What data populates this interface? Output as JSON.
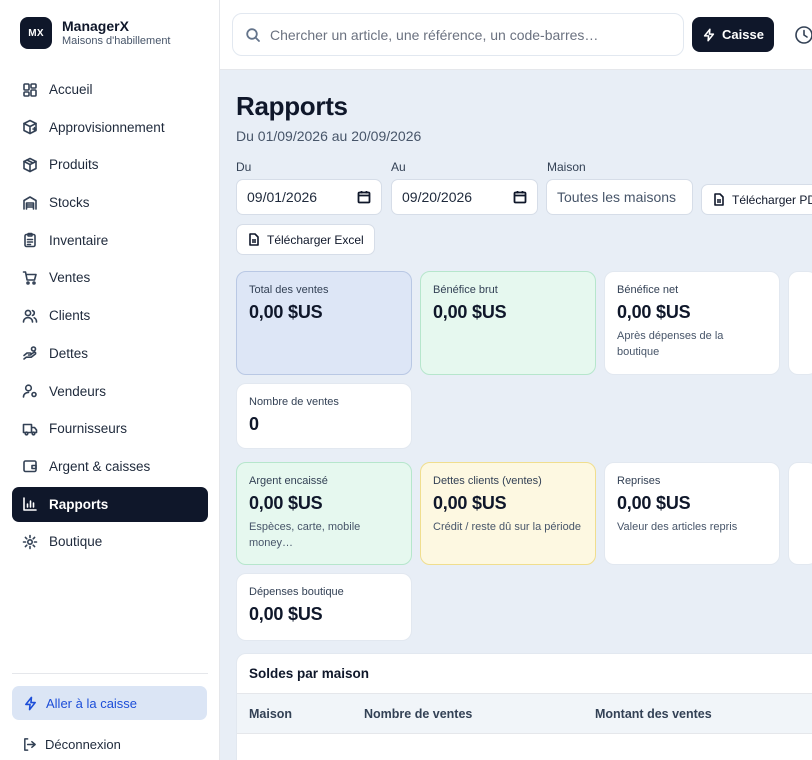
{
  "brand": {
    "logo": "MX",
    "name": "ManagerX",
    "subtitle": "Maisons d'habillement"
  },
  "nav": [
    {
      "label": "Accueil",
      "icon": "grid-icon",
      "active": false
    },
    {
      "label": "Approvisionnement",
      "icon": "package-plus-icon",
      "active": false
    },
    {
      "label": "Produits",
      "icon": "box-icon",
      "active": false
    },
    {
      "label": "Stocks",
      "icon": "warehouse-icon",
      "active": false
    },
    {
      "label": "Inventaire",
      "icon": "clipboard-icon",
      "active": false
    },
    {
      "label": "Ventes",
      "icon": "cart-icon",
      "active": false
    },
    {
      "label": "Clients",
      "icon": "users-icon",
      "active": false
    },
    {
      "label": "Dettes",
      "icon": "hand-coins-icon",
      "active": false
    },
    {
      "label": "Vendeurs",
      "icon": "user-icon",
      "active": false
    },
    {
      "label": "Fournisseurs",
      "icon": "truck-icon",
      "active": false
    },
    {
      "label": "Argent & caisses",
      "icon": "wallet-icon",
      "active": false
    },
    {
      "label": "Rapports",
      "icon": "bar-chart-icon",
      "active": true
    },
    {
      "label": "Boutique",
      "icon": "settings-icon",
      "active": false
    }
  ],
  "sidebar_footer": {
    "pos_label": "Aller à la caisse",
    "logout_label": "Déconnexion"
  },
  "topbar": {
    "search_placeholder": "Chercher un article, une référence, un code-barres…",
    "caisse_label": "Caisse"
  },
  "page": {
    "title": "Rapports",
    "subtitle": "Du 01/09/2026 au 20/09/2026"
  },
  "filters": {
    "from_label": "Du",
    "from_value": "09/01/2026",
    "to_label": "Au",
    "to_value": "09/20/2026",
    "house_label": "Maison",
    "house_value": "Toutes les maisons",
    "pdf_label": "Télécharger PDF",
    "excel_label": "Télécharger Excel"
  },
  "cards_group1": [
    {
      "label": "Total des ventes",
      "value": "0,00 $US",
      "note": "",
      "variant": "blue"
    },
    {
      "label": "Bénéfice brut",
      "value": "0,00 $US",
      "note": "",
      "variant": "green"
    },
    {
      "label": "Bénéfice net",
      "value": "0,00 $US",
      "note": "Après dépenses de la boutique",
      "variant": "white"
    },
    {
      "label": "Nombre de ventes",
      "value": "0",
      "note": "",
      "variant": "white"
    }
  ],
  "cards_group2": [
    {
      "label": "Argent encaissé",
      "value": "0,00 $US",
      "note": "Espèces, carte, mobile money…",
      "variant": "green"
    },
    {
      "label": "Dettes clients (ventes)",
      "value": "0,00 $US",
      "note": "Crédit / reste dû sur la période",
      "variant": "yellow"
    },
    {
      "label": "Reprises",
      "value": "0,00 $US",
      "note": "Valeur des articles repris",
      "variant": "white"
    },
    {
      "label": "Dépenses boutique",
      "value": "0,00 $US",
      "note": "",
      "variant": "white"
    }
  ],
  "balances": {
    "title": "Soldes par maison",
    "columns": [
      "Maison",
      "Nombre de ventes",
      "Montant des ventes"
    ]
  }
}
